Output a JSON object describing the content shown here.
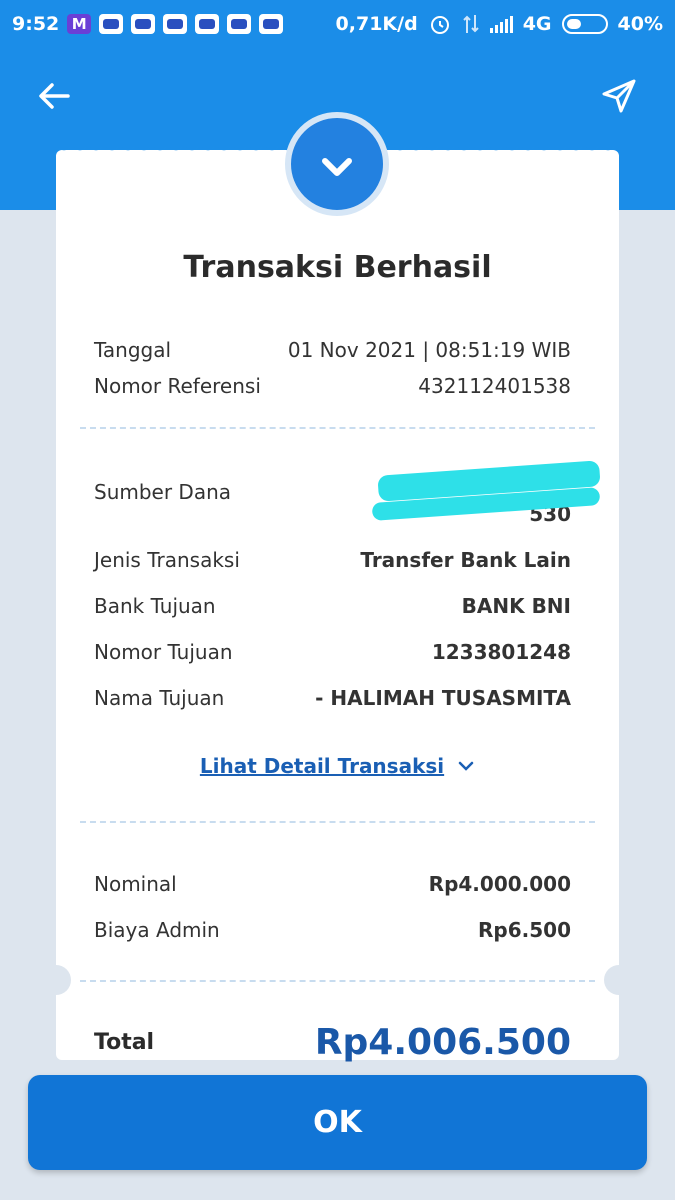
{
  "statusbar": {
    "time": "9:52",
    "network_speed": "0,71K/d",
    "network_type": "4G",
    "battery": "40%",
    "battery_level": 0.4,
    "notification_icons": [
      "gmail-icon",
      "app-icon",
      "app-icon",
      "app-icon",
      "app-icon",
      "app-icon",
      "app-icon"
    ]
  },
  "header": {
    "back_icon": "arrow-left-icon",
    "share_icon": "send-icon"
  },
  "receipt": {
    "status_icon": "check-chevron-icon",
    "title": "Transaksi Berhasil",
    "tanggal_label": "Tanggal",
    "tanggal_value": "01 Nov 2021 | 08:51:19 WIB",
    "referensi_label": "Nomor Referensi",
    "referensi_value": "432112401538",
    "sumber_label": "Sumber Dana",
    "sumber_value_line2": "530",
    "jenis_label": "Jenis Transaksi",
    "jenis_value": "Transfer Bank Lain",
    "bank_label": "Bank Tujuan",
    "bank_value": "BANK BNI",
    "nomor_tujuan_label": "Nomor Tujuan",
    "nomor_tujuan_value": "1233801248",
    "nama_label": "Nama Tujuan",
    "nama_value": "- HALIMAH  TUSASMITA",
    "detail_link": "Lihat Detail Transaksi",
    "nominal_label": "Nominal",
    "nominal_value": "Rp4.000.000",
    "admin_label": "Biaya Admin",
    "admin_value": "Rp6.500",
    "total_label": "Total",
    "total_value": "Rp4.006.500"
  },
  "actions": {
    "ok_label": "OK"
  },
  "colors": {
    "header_blue": "#1b8de8",
    "button_blue": "#1175d6",
    "total_blue": "#1a58a8",
    "link_blue": "#1a5fb4",
    "background": "#dde5ee"
  }
}
